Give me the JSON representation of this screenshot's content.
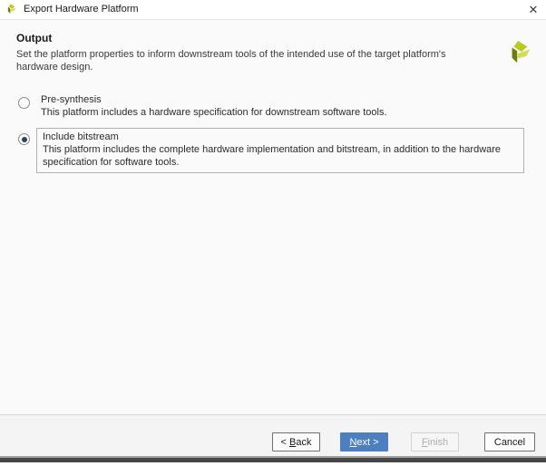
{
  "window": {
    "title": "Export Hardware Platform"
  },
  "icons": {
    "close_glyph": "✕",
    "app_logo": "xilinx-logo",
    "header_logo": "xilinx-logo"
  },
  "header": {
    "title": "Output",
    "subtitle": "Set the platform properties to inform downstream tools of the intended use of the target platform's hardware design."
  },
  "options": [
    {
      "label": "Pre-synthesis",
      "description": "This platform includes a hardware specification for downstream software tools.",
      "selected": false
    },
    {
      "label": "Include bitstream",
      "description": "This platform includes the complete hardware implementation and bitstream, in addition to the hardware specification for software tools.",
      "selected": true
    }
  ],
  "footer": {
    "back": {
      "pre": "< ",
      "mnemonic": "B",
      "post": "ack"
    },
    "next": {
      "pre": "",
      "mnemonic": "N",
      "post": "ext >"
    },
    "finish": {
      "pre": "",
      "mnemonic": "F",
      "post": "inish"
    },
    "cancel": {
      "pre": "",
      "mnemonic": "",
      "post": "Cancel"
    }
  },
  "colors": {
    "primary_button": "#4d7fc0",
    "radio_selected_dot": "#33405e",
    "logo_dark": "#6e7c0a",
    "logo_mid": "#b9cc1e",
    "logo_light": "#d2dd55",
    "bottom_bar": "#4a4a4a"
  }
}
